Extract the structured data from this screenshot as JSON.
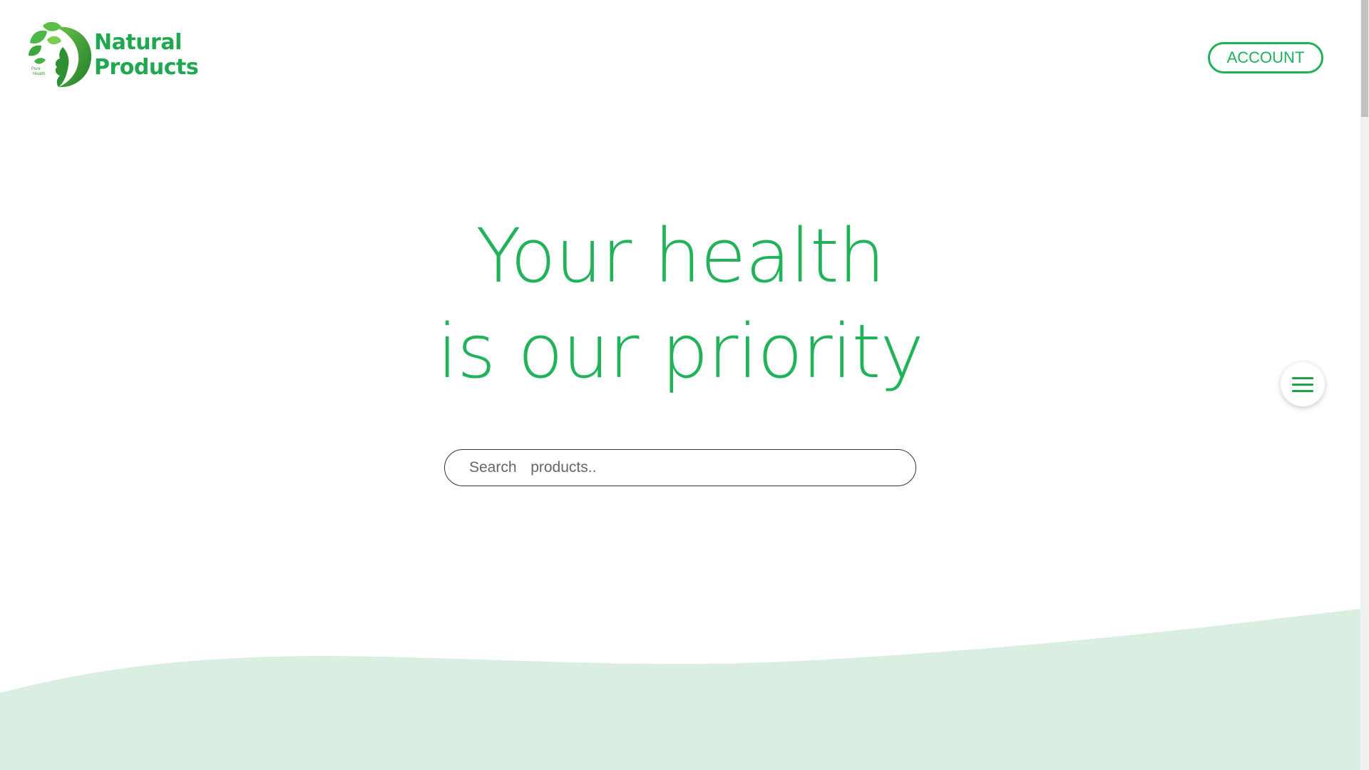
{
  "header": {
    "logo": {
      "tagline": "Pure Health",
      "line1": "Natural",
      "line2": "Products"
    },
    "account_label": "ACCOUNT"
  },
  "hero": {
    "title_line1": "Your health",
    "title_line2": "is our priority"
  },
  "search": {
    "placeholder": "Search  products..",
    "value": ""
  },
  "menu_button": {
    "icon": "hamburger-menu-icon"
  },
  "colors": {
    "brand_green": "#22b25a",
    "button_border": "#1fb05a",
    "wave_fill": "#daeee2"
  }
}
